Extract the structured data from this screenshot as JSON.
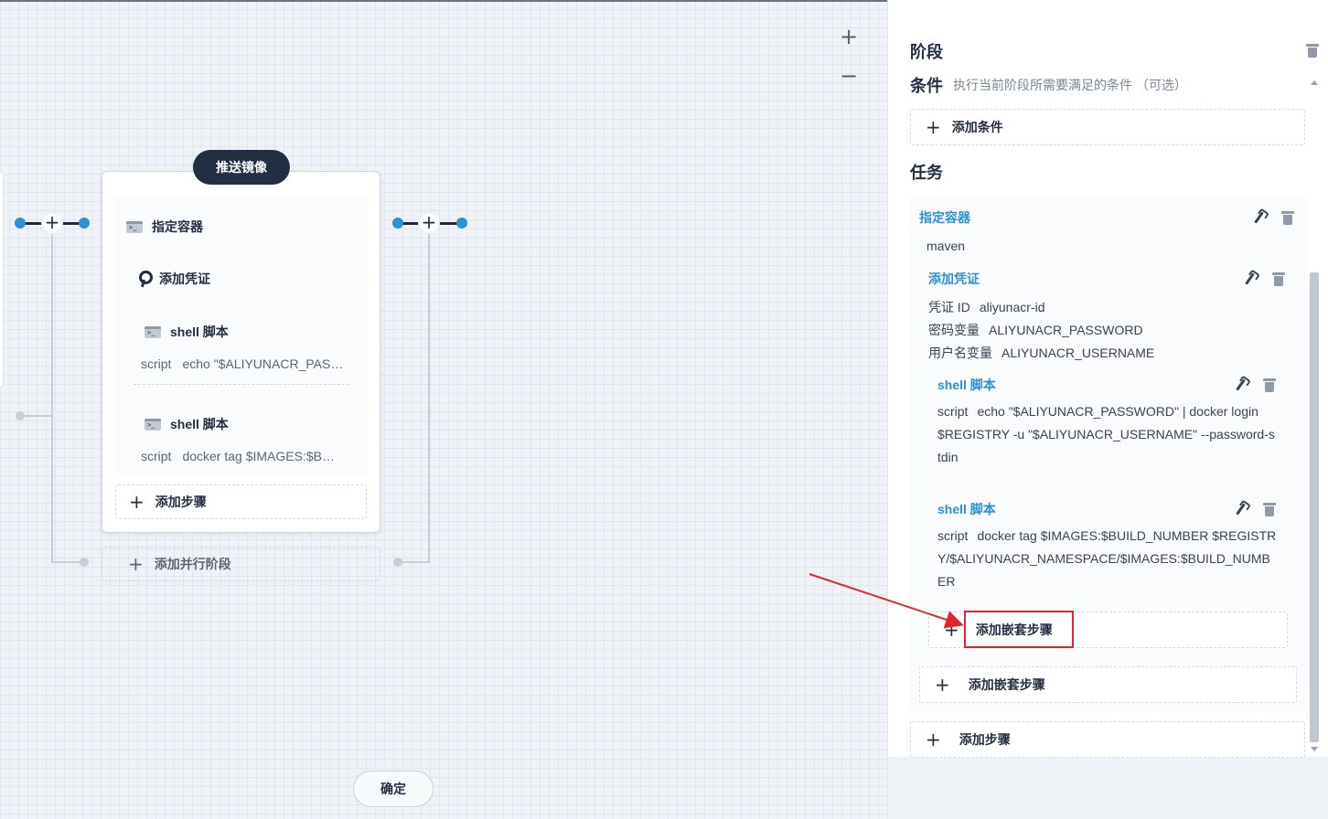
{
  "canvas": {
    "zoom_in": "+",
    "zoom_out": "−",
    "stage": {
      "title": "推送镜像",
      "steps": [
        {
          "label": "指定容器",
          "icon": "terminal-icon"
        },
        {
          "label": "添加凭证",
          "icon": "key-icon"
        },
        {
          "label": "shell 脚本",
          "icon": "terminal-icon",
          "script_key": "script",
          "script_value": "echo \"$ALIYUNACR_PASSWORD\" | docker login $REGISTRY -u \"$ALIYUNACR_USERNAME\" --password-stdin"
        },
        {
          "label": "shell 脚本",
          "icon": "terminal-icon",
          "script_key": "script",
          "script_value": "docker tag $IMAGES:$BUILD_NUMBER $REGISTRY/$ALIYUNACR_NAMESPACE/$IMAGES:$BUILD_NUMBER"
        }
      ],
      "add_step": "添加步骤",
      "add_parallel": "添加并行阶段"
    }
  },
  "panel": {
    "stage_heading": "阶段",
    "condition_heading": "条件",
    "condition_note": "执行当前阶段所需要满足的条件 （可选）",
    "add_condition": "添加条件",
    "task_heading": "任务",
    "container": {
      "title": "指定容器",
      "value": "maven"
    },
    "credential": {
      "title": "添加凭证",
      "rows": [
        {
          "key": "凭证 ID",
          "value": "aliyunacr-id"
        },
        {
          "key": "密码变量",
          "value": "ALIYUNACR_PASSWORD"
        },
        {
          "key": "用户名变量",
          "value": "ALIYUNACR_USERNAME"
        }
      ]
    },
    "shell1": {
      "title": "shell 脚本",
      "key": "script",
      "value": "echo \"$ALIYUNACR_PASSWORD\" | docker login $REGISTRY -u \"$ALIYUNACR_USERNAME\" --password-stdin"
    },
    "shell2": {
      "title": "shell 脚本",
      "key": "script",
      "value": "docker tag $IMAGES:$BUILD_NUMBER $REGISTRY/$ALIYUNACR_NAMESPACE/$IMAGES:$BUILD_NUMBER"
    },
    "add_nested_inner": "添加嵌套步骤",
    "add_nested_outer": "添加嵌套步骤",
    "add_step": "添加步骤",
    "confirm": "确定"
  },
  "colors": {
    "accent": "#2a91d5",
    "dark": "#242e42",
    "highlight": "#e0262b"
  }
}
